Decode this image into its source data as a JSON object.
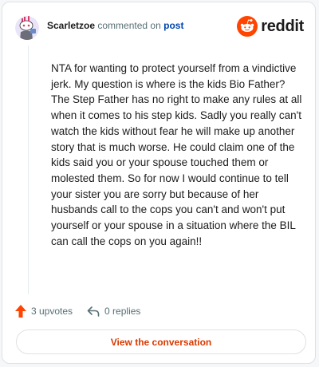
{
  "header": {
    "username": "Scarletzoe",
    "commented_text": "commented on",
    "post_link": "post",
    "brand": "reddit",
    "brand_color": "#ff4500",
    "avatar_icon": "snoo-avatar-icon"
  },
  "comment": {
    "text": "NTA for wanting to protect yourself from a vindictive jerk. My question is where is the kids Bio Father? The Step Father has no right to make any rules at all when it comes to his step kids. Sadly you really can't watch the kids without fear he will make up another story that is much worse. He could claim one of the kids said you or your spouse touched them or molested them. So for now I would continue to tell your sister you are sorry but because of her husbands call to the cops you can't and won't put yourself or your spouse in a situation where the BIL can call the cops on you again!!"
  },
  "actions": {
    "upvotes": "3 upvotes",
    "replies": "0 replies",
    "upvote_color": "#ff4500"
  },
  "cta": {
    "label": "View the conversation",
    "color": "#d93900"
  }
}
